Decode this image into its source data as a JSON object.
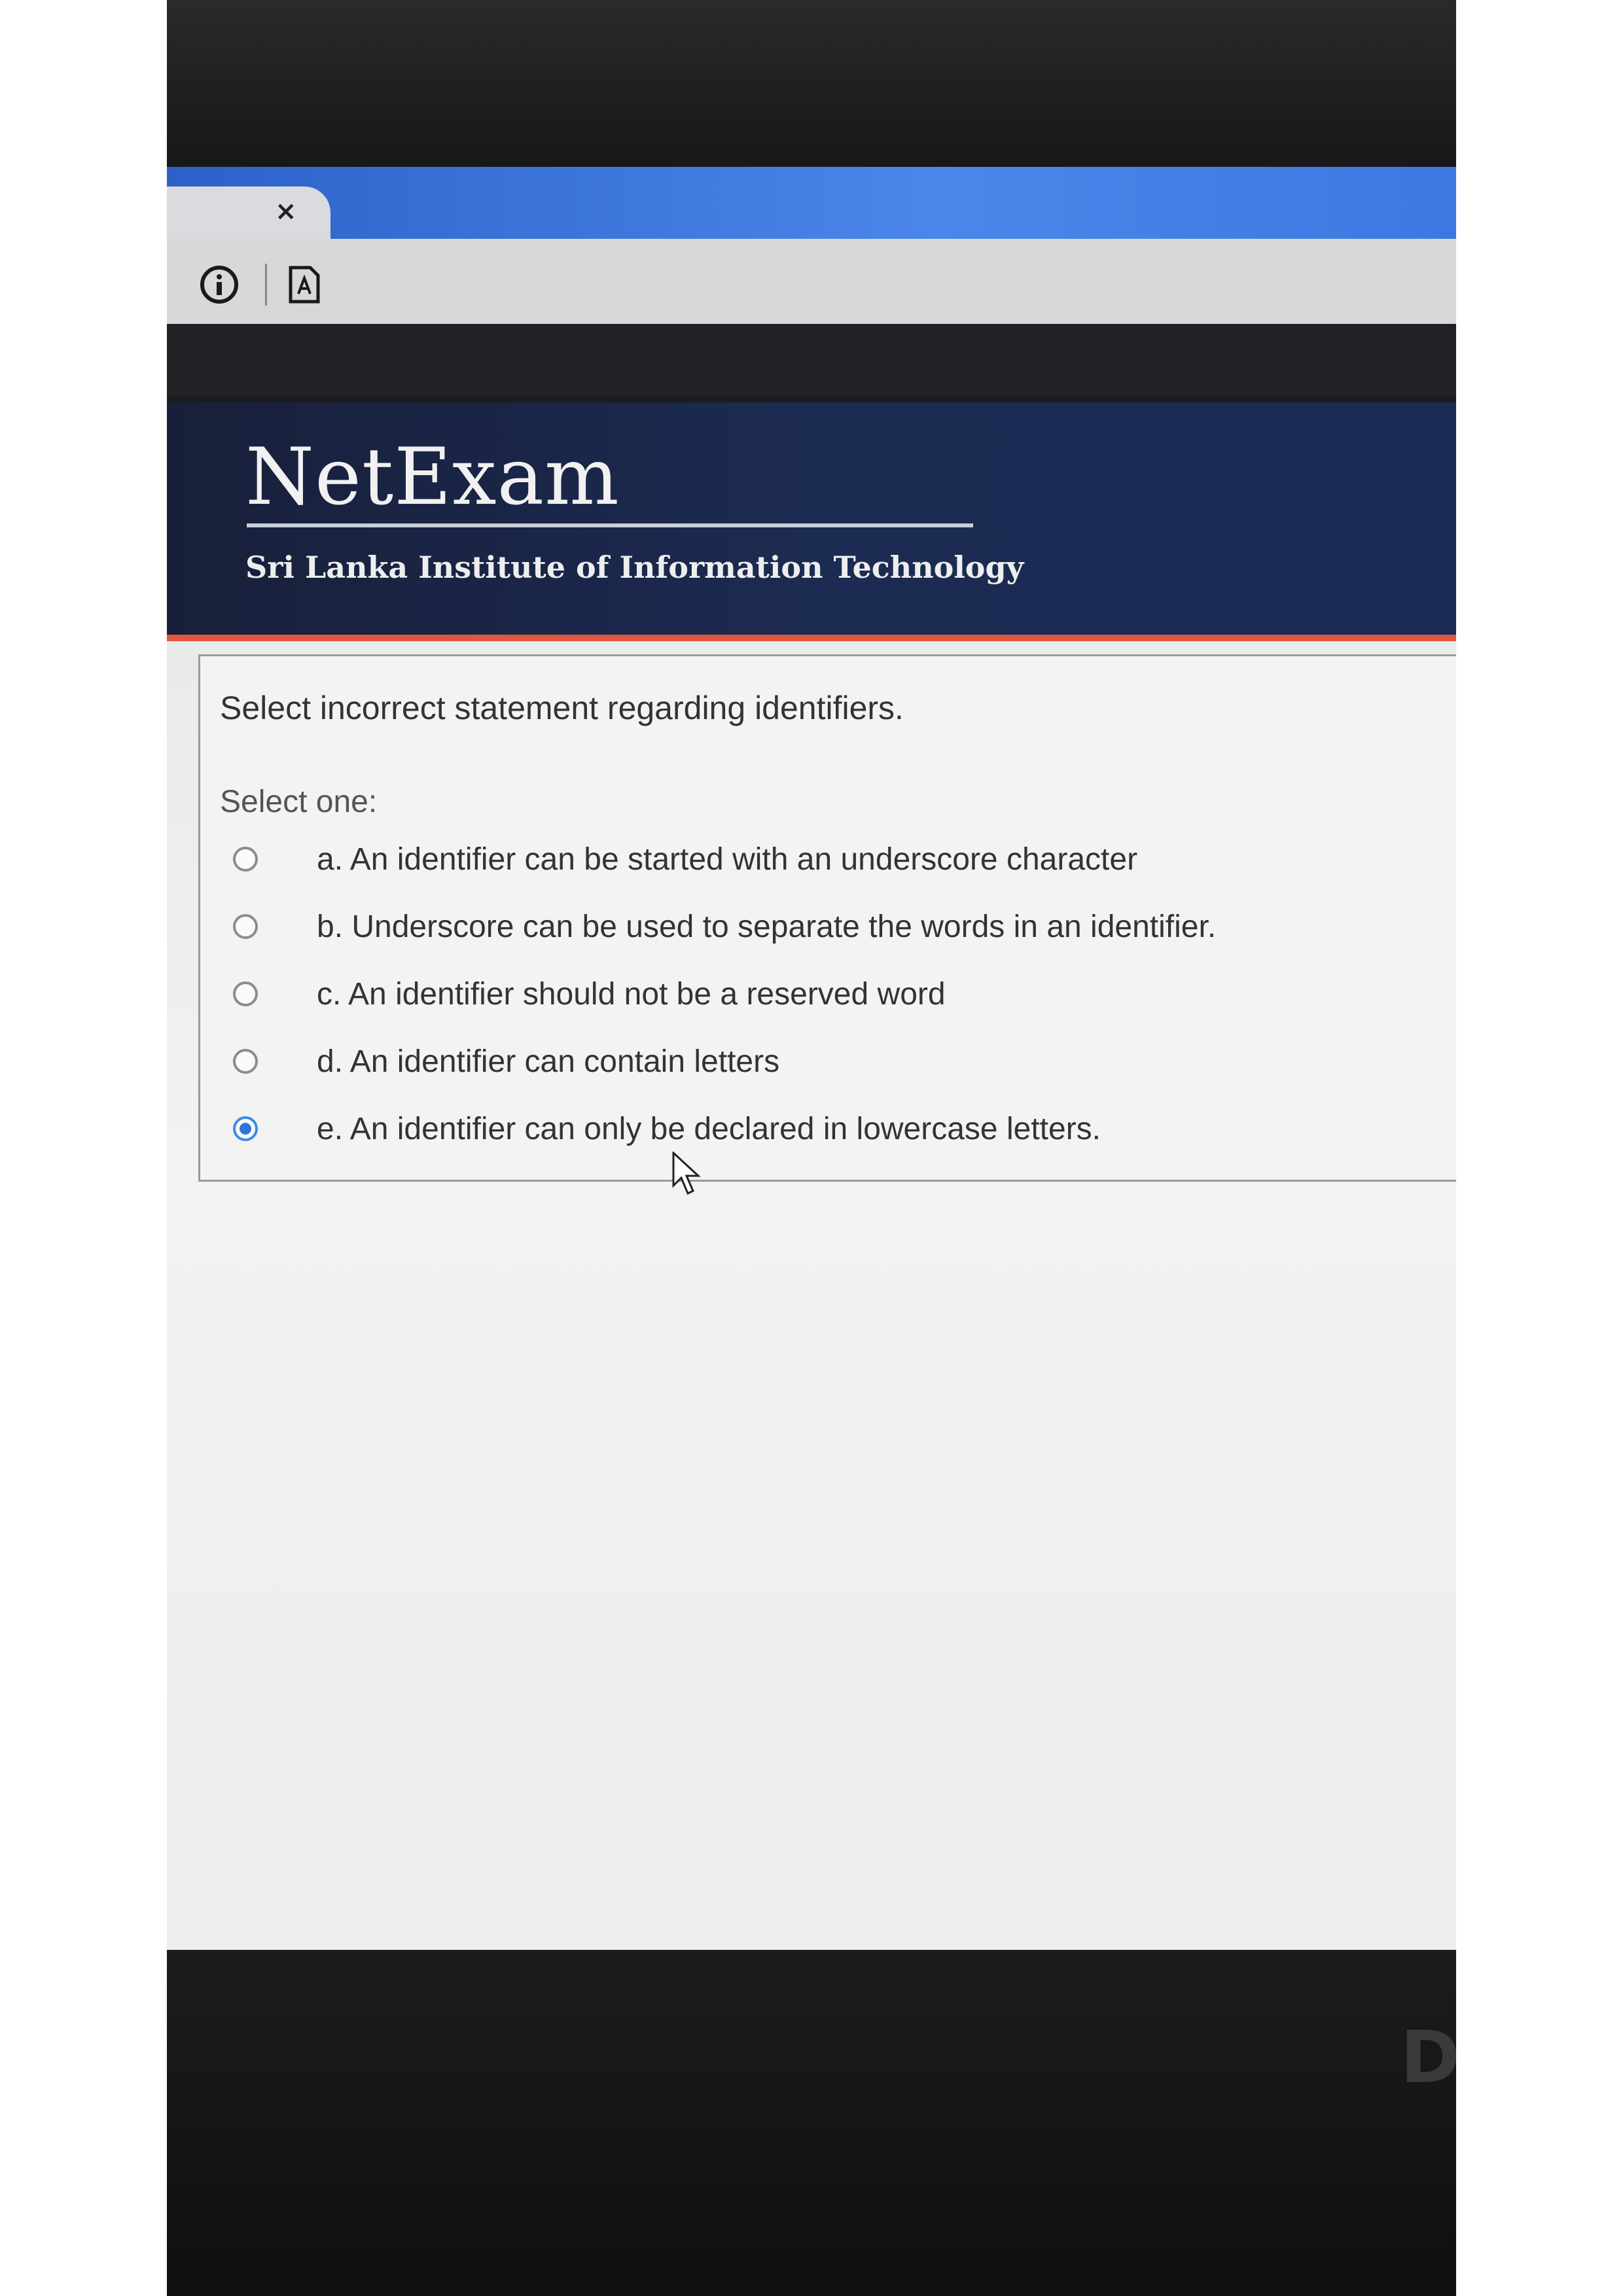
{
  "browser": {
    "tab_close_glyph": "×"
  },
  "site": {
    "logo": "NetExam",
    "institute": "Sri Lanka Institute of Information Technology"
  },
  "quiz": {
    "question": "Select incorrect statement regarding identifiers.",
    "prompt": "Select one:",
    "selected_option": "e",
    "options": [
      {
        "label": "a. An identifier can be started with an underscore character",
        "checked": false
      },
      {
        "label": "b. Underscore can be used to separate the words in an identifier.",
        "checked": false
      },
      {
        "label": "c. An identifier should not be a reserved word",
        "checked": false
      },
      {
        "label": "d. An identifier can contain letters",
        "checked": false
      },
      {
        "label": "e. An identifier can only be declared in lowercase letters.",
        "checked": true
      }
    ]
  },
  "device": {
    "brand_partial": "D"
  },
  "colors": {
    "header_bg": "#1c2b52",
    "header_accent": "#e0563f",
    "tab_strip": "#3c78e0",
    "radio_checked": "#2d76d9"
  }
}
